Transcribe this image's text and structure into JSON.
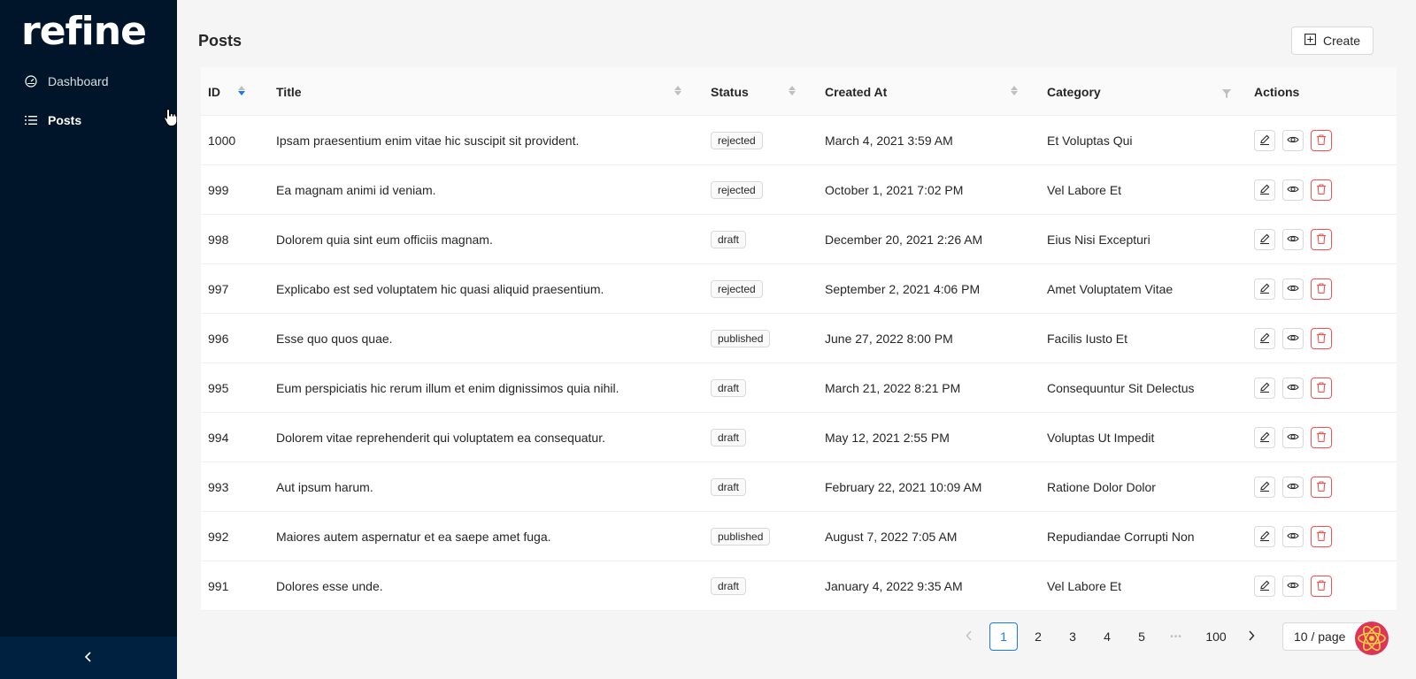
{
  "app": {
    "logo_text": "refine"
  },
  "sidebar": {
    "items": [
      {
        "label": "Dashboard",
        "icon": "dashboard-icon"
      },
      {
        "label": "Posts",
        "icon": "list-icon"
      }
    ],
    "collapse_icon": "chevron-left-icon"
  },
  "page": {
    "title": "Posts",
    "create_label": "Create"
  },
  "table": {
    "columns": [
      "ID",
      "Title",
      "Status",
      "Created At",
      "Category",
      "Actions"
    ],
    "rows": [
      {
        "id": "1000",
        "title": "Ipsam praesentium enim vitae hic suscipit sit provident.",
        "status": "rejected",
        "created_at": "March 4, 2021 3:59 AM",
        "category": "Et Voluptas Qui"
      },
      {
        "id": "999",
        "title": "Ea magnam animi id veniam.",
        "status": "rejected",
        "created_at": "October 1, 2021 7:02 PM",
        "category": "Vel Labore Et"
      },
      {
        "id": "998",
        "title": "Dolorem quia sint eum officiis magnam.",
        "status": "draft",
        "created_at": "December 20, 2021 2:26 AM",
        "category": "Eius Nisi Excepturi"
      },
      {
        "id": "997",
        "title": "Explicabo est sed voluptatem hic quasi aliquid praesentium.",
        "status": "rejected",
        "created_at": "September 2, 2021 4:06 PM",
        "category": "Amet Voluptatem Vitae"
      },
      {
        "id": "996",
        "title": "Esse quo quos quae.",
        "status": "published",
        "created_at": "June 27, 2022 8:00 PM",
        "category": "Facilis Iusto Et"
      },
      {
        "id": "995",
        "title": "Eum perspiciatis hic rerum illum et enim dignissimos quia nihil.",
        "status": "draft",
        "created_at": "March 21, 2022 8:21 PM",
        "category": "Consequuntur Sit Delectus"
      },
      {
        "id": "994",
        "title": "Dolorem vitae reprehenderit qui voluptatem ea consequatur.",
        "status": "draft",
        "created_at": "May 12, 2021 2:55 PM",
        "category": "Voluptas Ut Impedit"
      },
      {
        "id": "993",
        "title": "Aut ipsum harum.",
        "status": "draft",
        "created_at": "February 22, 2021 10:09 AM",
        "category": "Ratione Dolor Dolor"
      },
      {
        "id": "992",
        "title": "Maiores autem aspernatur et ea saepe amet fuga.",
        "status": "published",
        "created_at": "August 7, 2022 7:05 AM",
        "category": "Repudiandae Corrupti Non"
      },
      {
        "id": "991",
        "title": "Dolores esse unde.",
        "status": "draft",
        "created_at": "January 4, 2022 9:35 AM",
        "category": "Vel Labore Et"
      }
    ]
  },
  "pagination": {
    "pages": [
      "1",
      "2",
      "3",
      "4",
      "5"
    ],
    "ellipsis": "•••",
    "last_page": "100",
    "current": "1",
    "page_size": "10 / page"
  },
  "colors": {
    "sidebar_bg": "#001529",
    "primary": "#1677ff",
    "danger": "#ff4d4f"
  }
}
